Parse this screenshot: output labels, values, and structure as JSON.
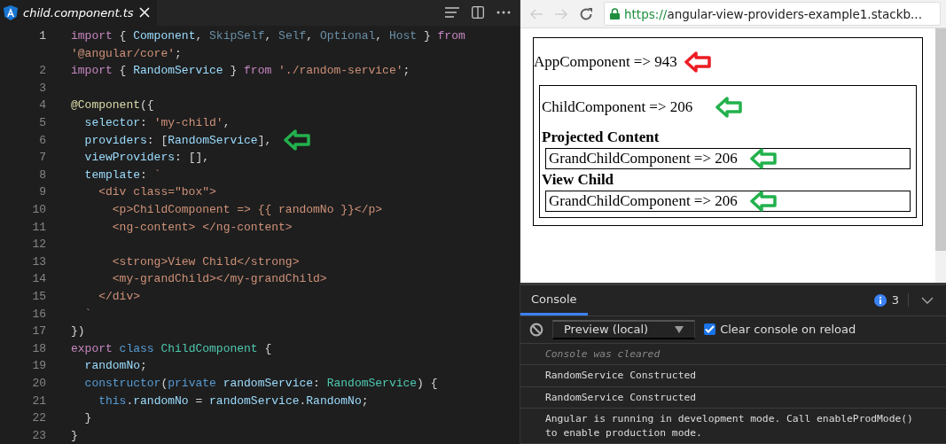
{
  "editor": {
    "tab": {
      "title": "child.component.ts",
      "selected": true
    },
    "lines": [
      {
        "number": "1",
        "tokens": [
          {
            "kind": "kw",
            "text": "import"
          },
          {
            "kind": "p",
            "text": " { "
          },
          {
            "kind": "var",
            "text": "Component"
          },
          {
            "kind": "p",
            "text": ", "
          },
          {
            "kind": "dim",
            "text": "SkipSelf"
          },
          {
            "kind": "p",
            "text": ", "
          },
          {
            "kind": "dim",
            "text": "Self"
          },
          {
            "kind": "p",
            "text": ", "
          },
          {
            "kind": "dim",
            "text": "Optional"
          },
          {
            "kind": "p",
            "text": ", "
          },
          {
            "kind": "dim",
            "text": "Host"
          },
          {
            "kind": "p",
            "text": " } "
          },
          {
            "kind": "kw",
            "text": "from"
          }
        ]
      },
      {
        "tokens": [
          {
            "kind": "str",
            "text": "'@angular/core'"
          },
          {
            "kind": "p",
            "text": ";"
          }
        ]
      },
      {
        "number": "2",
        "tokens": [
          {
            "kind": "kw",
            "text": "import"
          },
          {
            "kind": "p",
            "text": " { "
          },
          {
            "kind": "var",
            "text": "RandomService"
          },
          {
            "kind": "p",
            "text": " } "
          },
          {
            "kind": "kw",
            "text": "from"
          },
          {
            "kind": "str",
            "text": " './random-service'"
          },
          {
            "kind": "p",
            "text": ";"
          }
        ]
      },
      {
        "number": "3"
      },
      {
        "number": "4",
        "tokens": [
          {
            "kind": "fn",
            "text": "@Component"
          },
          {
            "kind": "p",
            "text": "({"
          }
        ]
      },
      {
        "number": "5",
        "tokens": [
          {
            "kind": "var",
            "text": "  selector"
          },
          {
            "kind": "p",
            "text": ": "
          },
          {
            "kind": "str",
            "text": "'my-child'"
          },
          {
            "kind": "p",
            "text": ","
          }
        ]
      },
      {
        "number": "6",
        "tokens": [
          {
            "kind": "var",
            "text": "  providers"
          },
          {
            "kind": "p",
            "text": ": ["
          },
          {
            "kind": "var",
            "text": "RandomService"
          },
          {
            "kind": "p",
            "text": "],"
          }
        ],
        "arrow": {
          "color": "#22b14c"
        }
      },
      {
        "number": "7",
        "tokens": [
          {
            "kind": "var",
            "text": "  viewProviders"
          },
          {
            "kind": "p",
            "text": ": [],"
          }
        ]
      },
      {
        "number": "8",
        "tokens": [
          {
            "kind": "var",
            "text": "  template"
          },
          {
            "kind": "p",
            "text": ": "
          },
          {
            "kind": "str",
            "text": "`"
          }
        ]
      },
      {
        "number": "9",
        "tokens": [
          {
            "kind": "str",
            "text": "    <div class=\"box\">"
          }
        ]
      },
      {
        "number": "10",
        "tokens": [
          {
            "kind": "str",
            "text": "      <p>ChildComponent => {{ randomNo }}</p>"
          }
        ]
      },
      {
        "number": "11",
        "tokens": [
          {
            "kind": "str",
            "text": "      <ng-content> </ng-content>"
          }
        ]
      },
      {
        "number": "12"
      },
      {
        "number": "13",
        "tokens": [
          {
            "kind": "str",
            "text": "      <strong>View Child</strong>"
          }
        ]
      },
      {
        "number": "14",
        "tokens": [
          {
            "kind": "str",
            "text": "      <my-grandChild></my-grandChild>"
          }
        ]
      },
      {
        "number": "15",
        "tokens": [
          {
            "kind": "str",
            "text": "    </div>"
          }
        ]
      },
      {
        "number": "16",
        "tokens": [
          {
            "kind": "str",
            "text": "  `"
          }
        ]
      },
      {
        "number": "17",
        "tokens": [
          {
            "kind": "p",
            "text": "})"
          }
        ]
      },
      {
        "number": "18",
        "tokens": [
          {
            "kind": "kw",
            "text": "export"
          },
          {
            "kind": "kw2",
            "text": " class"
          },
          {
            "kind": "type",
            "text": " ChildComponent"
          },
          {
            "kind": "p",
            "text": " {"
          }
        ]
      },
      {
        "number": "19",
        "tokens": [
          {
            "kind": "var",
            "text": "  randomNo"
          },
          {
            "kind": "p",
            "text": ";"
          }
        ]
      },
      {
        "number": "20",
        "tokens": [
          {
            "kind": "kw2",
            "text": "  constructor"
          },
          {
            "kind": "p",
            "text": "("
          },
          {
            "kind": "kw2",
            "text": "private"
          },
          {
            "kind": "var",
            "text": " randomService"
          },
          {
            "kind": "p",
            "text": ": "
          },
          {
            "kind": "type",
            "text": "RandomService"
          },
          {
            "kind": "p",
            "text": ") {"
          }
        ]
      },
      {
        "number": "21",
        "tokens": [
          {
            "kind": "kw2",
            "text": "    this"
          },
          {
            "kind": "p",
            "text": "."
          },
          {
            "kind": "var",
            "text": "randomNo"
          },
          {
            "kind": "p",
            "text": " = "
          },
          {
            "kind": "var",
            "text": "randomService"
          },
          {
            "kind": "p",
            "text": "."
          },
          {
            "kind": "var",
            "text": "RandomNo"
          },
          {
            "kind": "p",
            "text": ";"
          }
        ]
      },
      {
        "number": "22",
        "tokens": [
          {
            "kind": "p",
            "text": "  }"
          }
        ]
      },
      {
        "number": "23",
        "tokens": [
          {
            "kind": "p",
            "text": "}"
          }
        ]
      }
    ]
  },
  "browser": {
    "url_scheme": "https://",
    "url_rest": "angular-view-providers-example1.stackb...",
    "page": {
      "title": {
        "text": "AppComponent => 943",
        "arrow": {
          "color": "#ed1c24"
        }
      },
      "child": [
        {
          "kind": "text",
          "text": "ChildComponent => 206",
          "arrow": {
            "color": "#22b14c"
          }
        },
        {
          "kind": "heading",
          "text": "Projected Content"
        },
        {
          "kind": "box",
          "text": "GrandChildComponent => 206",
          "arrow": {
            "color": "#22b14c"
          }
        },
        {
          "kind": "heading",
          "text": "View Child"
        },
        {
          "kind": "box",
          "text": "GrandChildComponent => 206",
          "arrow": {
            "color": "#22b14c"
          }
        }
      ]
    }
  },
  "console": {
    "tabs": [
      {
        "label": "Console",
        "selected": true
      }
    ],
    "info_count": "3",
    "context": "Preview (local)",
    "clear_on_reload": {
      "label": "Clear console on reload",
      "checked": true
    },
    "messages": [
      {
        "kind": "system",
        "text": "Console was cleared"
      },
      {
        "kind": "log",
        "text": "RandomService Constructed"
      },
      {
        "kind": "log",
        "text": "RandomService Constructed"
      },
      {
        "kind": "log",
        "text": "Angular is running in development mode. Call enableProdMode() to enable production mode."
      }
    ]
  }
}
